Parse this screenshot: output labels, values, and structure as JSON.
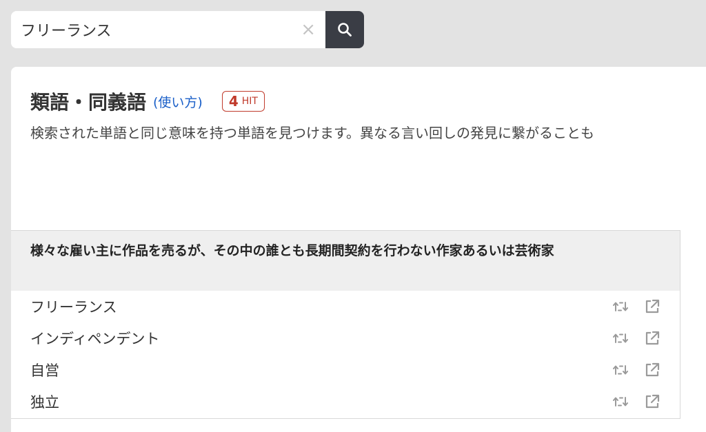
{
  "search": {
    "value": "フリーランス",
    "clear_symbol": "×"
  },
  "card": {
    "title": "類語・同義語",
    "usage_link": "(使い方)",
    "hit_count": "4",
    "hit_unit": "HIT",
    "description": "検索された単語と同じ意味を持つ単語を見つけます。異なる言い回しの発見に繋がることも"
  },
  "definition": "様々な雇い主に作品を売るが、その中の誰とも長期間契約を行わない作家あるいは芸術家",
  "words": [
    {
      "label": "フリーランス"
    },
    {
      "label": "インディペンデント"
    },
    {
      "label": "自営"
    },
    {
      "label": "独立"
    }
  ],
  "icons": {
    "search": "search-icon",
    "clear": "close-icon",
    "swap": "swap-icon",
    "external": "external-link-icon"
  },
  "colors": {
    "accent_link": "#1a5fc8",
    "hit_badge": "#c03a2b",
    "search_button": "#3a3d45"
  }
}
